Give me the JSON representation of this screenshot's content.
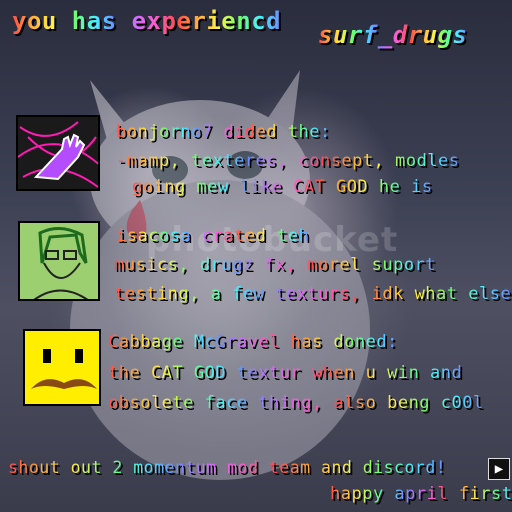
{
  "title": {
    "main": "you has experiencd",
    "brand": "surf_drugs"
  },
  "credits": [
    {
      "lines": [
        "bonjorno7 dided the:",
        "-mamp, texteres, consept, modles",
        "going mew like CAT GOD he is"
      ]
    },
    {
      "lines": [
        "isacosa crated teh",
        "musics, drugz fx, morel suport",
        "testing, a few texturs, idk what else"
      ]
    },
    {
      "lines": [
        "Cabbage McGravel has doned:",
        "the CAT GOD textur when u win and",
        "obsolete face thing, also beng c00l"
      ]
    }
  ],
  "footer": {
    "shoutout": "shout out 2 momentum mod team and discord!",
    "greeting": "happy april first!"
  },
  "watermark": "photobucket",
  "icons": {
    "next": "arrow-right-icon"
  },
  "colors": {
    "avatar1_bg": "#1a1a1a",
    "avatar2_bg": "#9ccf6f",
    "avatar3_bg": "#ffee00"
  }
}
